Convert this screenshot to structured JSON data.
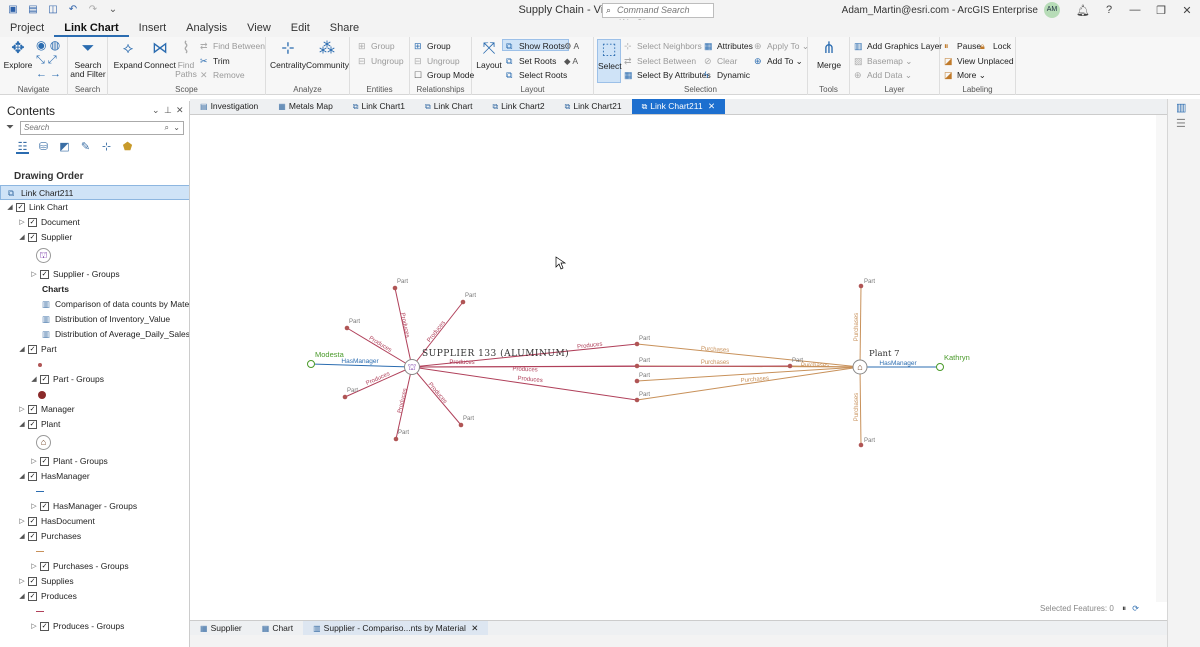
{
  "app": {
    "title": "Supply Chain - Visual Exploration",
    "command_search_placeholder": "Command Search (Alt+Q)",
    "user_name": "Adam_Martin@esri.com - ArcGIS Enterprise",
    "user_initials": "AM"
  },
  "ribbon_tabs": [
    "Project",
    "Link Chart",
    "Insert",
    "Analysis",
    "View",
    "Edit",
    "Share"
  ],
  "ribbon": {
    "navigate": {
      "label": "Navigate",
      "explore": "Explore"
    },
    "search": {
      "label": "Search",
      "search_filter": "Search and Filter"
    },
    "scope": {
      "label": "Scope",
      "expand": "Expand",
      "connect": "Connect",
      "find_paths": "Find Paths",
      "find_between": "Find Between",
      "trim": "Trim",
      "remove": "Remove"
    },
    "analyze": {
      "label": "Analyze",
      "centrality": "Centrality",
      "community": "Community"
    },
    "entities": {
      "label": "Entities",
      "group": "Group",
      "ungroup": "Ungroup"
    },
    "relationships": {
      "label": "Relationships",
      "group": "Group",
      "ungroup": "Ungroup",
      "group_mode": "Group Mode"
    },
    "layout": {
      "label": "Layout",
      "layout": "Layout",
      "show_roots": "Show Roots",
      "set_roots": "Set Roots",
      "select_roots": "Select Roots"
    },
    "selection": {
      "label": "Selection",
      "select": "Select",
      "select_neighbors": "Select Neighbors",
      "select_between": "Select Between",
      "select_by_attributes": "Select By Attributes",
      "attributes": "Attributes",
      "clear": "Clear",
      "dynamic": "Dynamic",
      "apply_to": "Apply To",
      "add_to": "Add To"
    },
    "tools": {
      "label": "Tools",
      "merge": "Merge"
    },
    "layer": {
      "label": "Layer",
      "add_graphics_layer": "Add Graphics Layer",
      "basemap": "Basemap",
      "add_data": "Add Data"
    },
    "labeling": {
      "label": "Labeling",
      "pause": "Pause",
      "lock": "Lock",
      "view_unplaced": "View Unplaced",
      "more": "More"
    }
  },
  "contents": {
    "title": "Contents",
    "search_placeholder": "Search",
    "drawing_order": "Drawing Order",
    "tree": [
      {
        "label": "Link Chart211",
        "level": 0,
        "toggle": "",
        "checkbox": false,
        "selected": true
      },
      {
        "label": "Link Chart",
        "level": 0,
        "toggle": "◢",
        "checkbox": true
      },
      {
        "label": "Document",
        "level": 1,
        "toggle": "▷",
        "checkbox": true
      },
      {
        "label": "Supplier",
        "level": 1,
        "toggle": "◢",
        "checkbox": true
      },
      {
        "label": "",
        "level": 2,
        "symbol": "supplier-symbol"
      },
      {
        "label": "Supplier - Groups",
        "level": 2,
        "toggle": "▷",
        "checkbox": true
      },
      {
        "label": "Charts",
        "level": 2,
        "bold": true
      },
      {
        "label": "Comparison of data counts by Material",
        "level": 2,
        "chart_icon": true
      },
      {
        "label": "Distribution of Inventory_Value",
        "level": 2,
        "chart_icon": true
      },
      {
        "label": "Distribution of Average_Daily_Sales",
        "level": 2,
        "chart_icon": true
      },
      {
        "label": "Part",
        "level": 1,
        "toggle": "◢",
        "checkbox": true
      },
      {
        "label": "",
        "level": 2,
        "symbol": "part-dot"
      },
      {
        "label": "Part - Groups",
        "level": 2,
        "toggle": "◢",
        "checkbox": true
      },
      {
        "label": "",
        "level": 2,
        "symbol": "part-group-dot"
      },
      {
        "label": "Manager",
        "level": 1,
        "toggle": "▷",
        "checkbox": true
      },
      {
        "label": "Plant",
        "level": 1,
        "toggle": "◢",
        "checkbox": true
      },
      {
        "label": "",
        "level": 2,
        "symbol": "plant-symbol"
      },
      {
        "label": "Plant - Groups",
        "level": 2,
        "toggle": "▷",
        "checkbox": true
      },
      {
        "label": "HasManager",
        "level": 1,
        "toggle": "◢",
        "checkbox": true
      },
      {
        "label": "",
        "level": 2,
        "symbol": "hasmanager-line"
      },
      {
        "label": "HasManager - Groups",
        "level": 2,
        "toggle": "▷",
        "checkbox": true
      },
      {
        "label": "HasDocument",
        "level": 1,
        "toggle": "▷",
        "checkbox": true
      },
      {
        "label": "Purchases",
        "level": 1,
        "toggle": "◢",
        "checkbox": true
      },
      {
        "label": "",
        "level": 2,
        "symbol": "purchases-line"
      },
      {
        "label": "Purchases - Groups",
        "level": 2,
        "toggle": "▷",
        "checkbox": true
      },
      {
        "label": "Supplies",
        "level": 1,
        "toggle": "▷",
        "checkbox": true
      },
      {
        "label": "Produces",
        "level": 1,
        "toggle": "◢",
        "checkbox": true
      },
      {
        "label": "",
        "level": 2,
        "symbol": "produces-line"
      },
      {
        "label": "Produces - Groups",
        "level": 2,
        "toggle": "▷",
        "checkbox": true
      }
    ]
  },
  "doc_tabs": [
    {
      "label": "Investigation",
      "icon": "folder"
    },
    {
      "label": "Metals Map",
      "icon": "map"
    },
    {
      "label": "Link Chart1",
      "icon": "linkchart"
    },
    {
      "label": "Link Chart",
      "icon": "linkchart"
    },
    {
      "label": "Link Chart2",
      "icon": "linkchart"
    },
    {
      "label": "Link Chart21",
      "icon": "linkchart"
    },
    {
      "label": "Link Chart211",
      "icon": "linkchart",
      "active": true,
      "closable": true
    }
  ],
  "bottom_tabs": [
    {
      "label": "Supplier",
      "icon": "table"
    },
    {
      "label": "Chart",
      "icon": "table"
    },
    {
      "label": "Supplier - Compariso...nts by Material",
      "icon": "chart",
      "active": true,
      "closable": true
    }
  ],
  "status": {
    "selected_features": "Selected Features: 0"
  },
  "graph": {
    "supplier_label": "SUPPLIER 133 (ALUMINUM)",
    "plant_label": "Plant 7",
    "manager_left": "Modesta",
    "manager_right": "Kathryn",
    "part_label": "Part",
    "produces_label": "Produces",
    "purchases_label": "Purchases",
    "has_manager_label": "HasManager",
    "colors": {
      "produces": "#b0405a",
      "purchases": "#c8915a",
      "has_manager": "#2b6cb0",
      "manager_text": "#4a9a2a",
      "part": "#b05555"
    }
  }
}
